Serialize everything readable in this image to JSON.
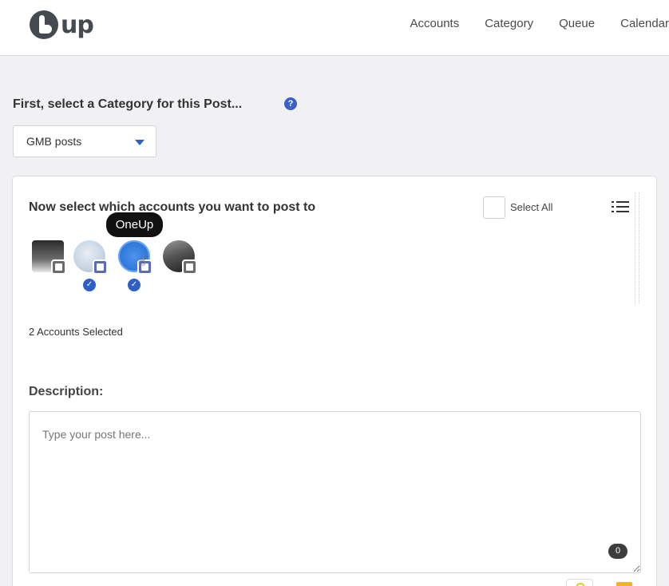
{
  "app": {
    "logo_text": "up"
  },
  "nav": {
    "items": [
      "Accounts",
      "Category",
      "Queue",
      "Calendar"
    ]
  },
  "category": {
    "heading": "First, select a Category for this Post...",
    "help_symbol": "?",
    "selected_value": "GMB posts"
  },
  "accounts_card": {
    "title": "Now select which accounts you want to post to",
    "select_all_label": "Select All",
    "tooltip": "OneUp",
    "selected_count_text": "2 Accounts Selected",
    "accounts": [
      {
        "selected": false,
        "badge_color": "#6b6b6b"
      },
      {
        "selected": true,
        "badge_color": "#5b6bb5"
      },
      {
        "selected": true,
        "badge_color": "#5b6bb5"
      },
      {
        "selected": false,
        "badge_color": "#6b6b6b"
      }
    ],
    "check_symbol": "✓"
  },
  "description": {
    "label": "Description:",
    "placeholder": "Type your post here...",
    "value": "",
    "char_count": "0"
  },
  "colors": {
    "accent": "#2f5fc4",
    "tooltip_bg": "#111111"
  }
}
